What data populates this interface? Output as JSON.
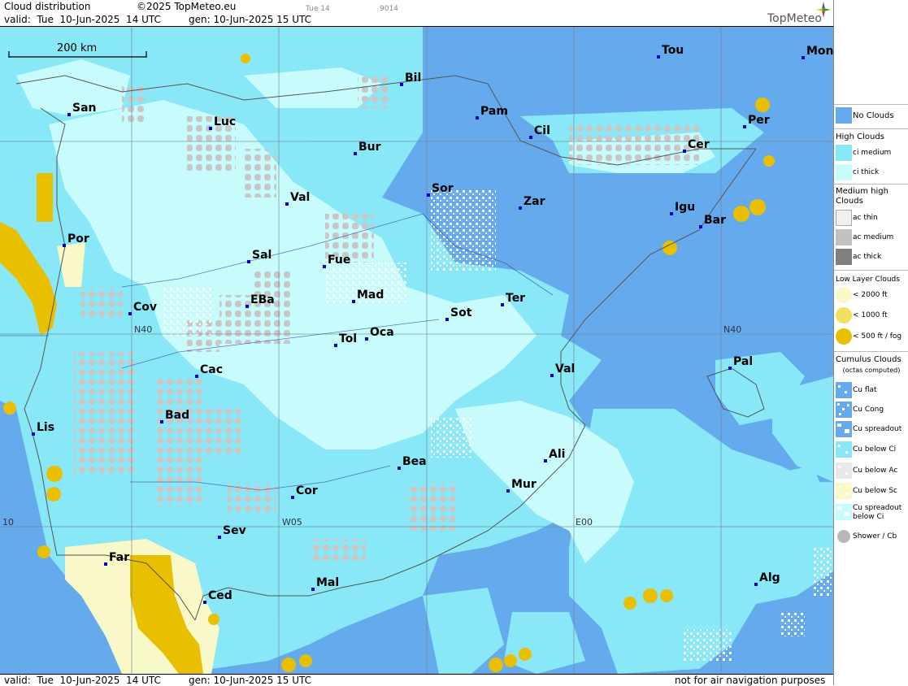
{
  "header": {
    "title": "Cloud distribution",
    "copyright": "©2025 TopMeteo.eu",
    "step": "Tue 14",
    "code": "9014",
    "valid": "valid:  Tue  10-Jun-2025  14 UTC",
    "gen": "gen: 10-Jun-2025 15 UTC",
    "brand": "TopMeteo"
  },
  "footer": {
    "valid": "valid:  Tue  10-Jun-2025  14 UTC",
    "gen": "gen: 10-Jun-2025 15 UTC",
    "note": "not for air navigation purposes"
  },
  "map": {
    "scale_label": "200 km",
    "grid_labels": {
      "n40_left": "N40",
      "n40_right": "N40",
      "w05": "W05",
      "e00": "E00",
      "w10": "10"
    },
    "cities": [
      "San",
      "Luc",
      "Bil",
      "Pam",
      "Cil",
      "Tou",
      "Mon",
      "Per",
      "Cer",
      "Bur",
      "Sor",
      "Zar",
      "Igu",
      "Bar",
      "Val",
      "Por",
      "Sal",
      "Fue",
      "Mad",
      "EBa",
      "Cov",
      "Ter",
      "Sot",
      "Tol",
      "Oca",
      "Pal",
      "Cac",
      "Val",
      "Bad",
      "Lis",
      "Ali",
      "Bea",
      "Mur",
      "Cor",
      "Sev",
      "Far",
      "Mal",
      "Alg",
      "Ced"
    ]
  },
  "legend": {
    "no_clouds": "No Clouds",
    "high": {
      "title": "High Clouds",
      "items": [
        "ci medium",
        "ci thick"
      ]
    },
    "medium": {
      "title": "Medium high Clouds",
      "items": [
        "ac thin",
        "ac medium",
        "ac thick"
      ]
    },
    "low": {
      "title": "Low Layer Clouds",
      "items": [
        "< 2000 ft",
        "< 1000 ft",
        "< 500 ft / fog"
      ]
    },
    "cumulus": {
      "title": "Cumulus Clouds",
      "subtitle": "(octas computed)",
      "items": [
        "Cu flat",
        "Cu Cong",
        "Cu spreadout",
        "Cu below Ci",
        "Cu below Ac",
        "Cu below Sc",
        "Cu spreadout below Ci",
        "Shower / Cb"
      ]
    }
  },
  "colors": {
    "no_clouds": "#66aaee",
    "ci_medium": "#88e8f8",
    "ci_thick": "#c8fcfc",
    "ac": "#c8c8c8",
    "ac_thick": "#808080",
    "low_2000": "#f8f8c8",
    "low_1000": "#f0e060",
    "fog": "#e8c000",
    "city": "#0000cc"
  }
}
